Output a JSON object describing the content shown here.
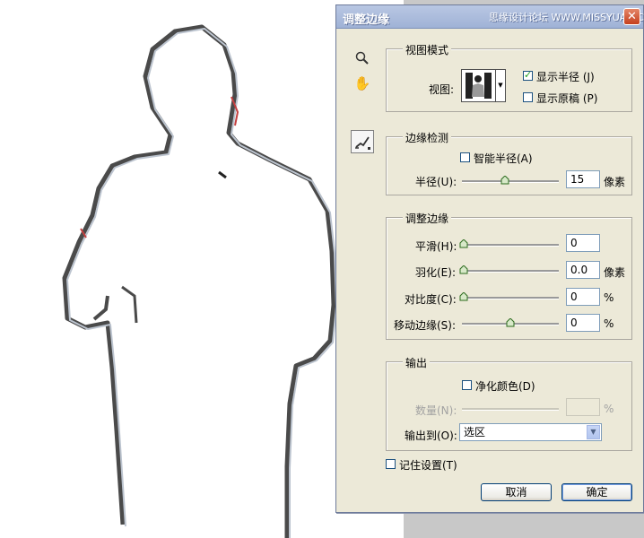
{
  "dialog": {
    "title": "调整边缘",
    "watermark": "思缘设计论坛 WWW.MISSYUAN.COM",
    "close_icon": "close-icon"
  },
  "tools": {
    "zoom": "magnifier-icon",
    "hand": "hand-icon",
    "brush": "refine-radius-brush-icon"
  },
  "view_mode": {
    "legend": "视图模式",
    "view_label": "视图:",
    "show_radius": {
      "label": "显示半径 (J)",
      "checked": true
    },
    "show_original": {
      "label": "显示原稿 (P)",
      "checked": false
    }
  },
  "edge_detection": {
    "legend": "边缘检测",
    "smart_radius": {
      "label": "智能半径(A)",
      "checked": false
    },
    "radius_label": "半径(U):",
    "radius_value": "15",
    "radius_unit": "像素",
    "radius_slider_level": 0.45
  },
  "adjust_edge": {
    "legend": "调整边缘",
    "rows": [
      {
        "label": "平滑(H):",
        "value": "0",
        "unit": "",
        "level": 0
      },
      {
        "label": "羽化(E):",
        "value": "0.0",
        "unit": "像素",
        "level": 0
      },
      {
        "label": "对比度(C):",
        "value": "0",
        "unit": "%",
        "level": 0
      },
      {
        "label": "移动边缘(S):",
        "value": "0",
        "unit": "%",
        "level": 0.5
      }
    ]
  },
  "output": {
    "legend": "输出",
    "decontaminate": {
      "label": "净化颜色(D)",
      "checked": false
    },
    "amount_label": "数量(N):",
    "amount_unit": "%",
    "output_to_label": "输出到(O):",
    "output_to_value": "选区"
  },
  "remember": {
    "label": "记住设置(T)",
    "checked": false
  },
  "buttons": {
    "cancel": "取消",
    "ok": "确定"
  }
}
